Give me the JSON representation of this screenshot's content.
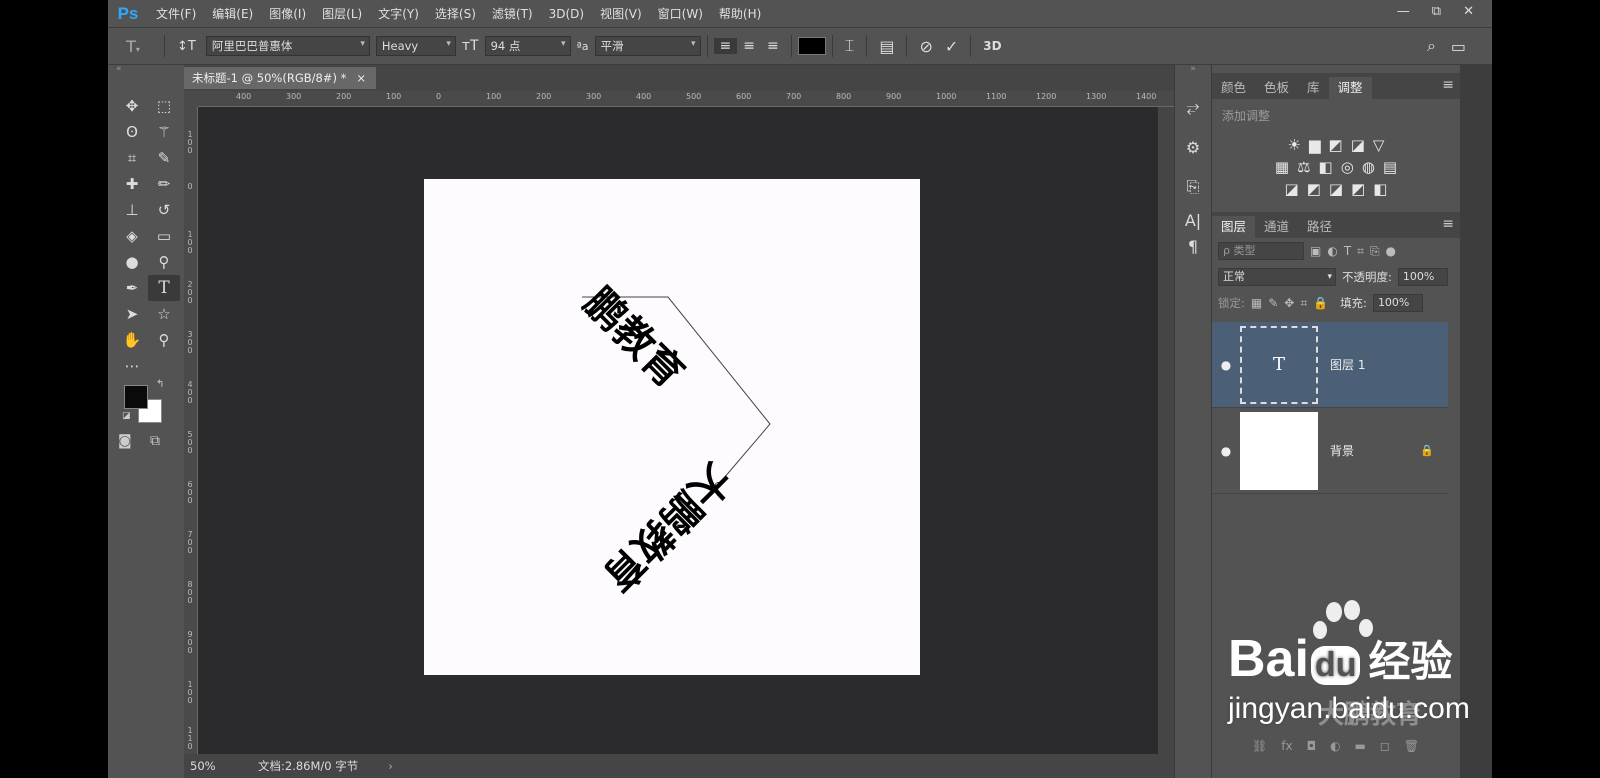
{
  "menu": {
    "logo": "Ps",
    "items": [
      "文件(F)",
      "编辑(E)",
      "图像(I)",
      "图层(L)",
      "文字(Y)",
      "选择(S)",
      "滤镜(T)",
      "3D(D)",
      "视图(V)",
      "窗口(W)",
      "帮助(H)"
    ]
  },
  "window_controls": {
    "minimize": "—",
    "restore": "⧉",
    "close": "✕"
  },
  "options": {
    "font_family": "阿里巴巴普惠体",
    "font_style": "Heavy",
    "font_size": "94 点",
    "aa_label": "ªa",
    "antialias": "平滑",
    "text_color": "#000000",
    "commit_3d": "3D"
  },
  "document": {
    "tab_title": "未标题-1 @ 50%(RGB/8#) *",
    "tab_close": "×",
    "zoom": "50%",
    "doc_info": "文档:2.86M/0 字节",
    "ruler_top": [
      "400",
      "300",
      "200",
      "100",
      "0",
      "100",
      "200",
      "300",
      "400",
      "500",
      "600",
      "700",
      "800",
      "900",
      "1000",
      "1100",
      "1200",
      "1300",
      "1400"
    ],
    "ruler_left": [
      "1\n0\n0",
      "0",
      "1\n0\n0",
      "2\n0\n0",
      "3\n0\n0",
      "4\n0\n0",
      "5\n0\n0",
      "6\n0\n0",
      "7\n0\n0",
      "8\n0\n0",
      "9\n0\n0",
      "1\n0\n0",
      "1\n1\n0"
    ],
    "path_text_upper": "鹏教育",
    "path_text_lower": "大鹏教育",
    "canvas_bg": "#2b2a2c"
  },
  "adjust_panel": {
    "tabs": [
      "颜色",
      "色板",
      "库",
      "调整"
    ],
    "active_tab": "调整",
    "title": "添加调整",
    "row1": [
      "☀",
      "▆",
      "◩",
      "◪",
      "▽"
    ],
    "row2": [
      "▦",
      "⚖",
      "◧",
      "◎",
      "◍",
      "▤"
    ],
    "row3": [
      "◪",
      "◩",
      "◪",
      "◩",
      "◧"
    ]
  },
  "layers_panel": {
    "tabs": [
      "图层",
      "通道",
      "路径"
    ],
    "active_tab": "图层",
    "filter_placeholder": "ρ 类型",
    "blend_mode": "正常",
    "opacity_label": "不透明度:",
    "opacity_value": "100%",
    "lock_label": "锁定:",
    "fill_label": "填充:",
    "fill_value": "100%",
    "layers": [
      {
        "name": "图层 1",
        "type": "text",
        "thumb_label": "T",
        "selected": true
      },
      {
        "name": "背景",
        "type": "image",
        "locked": true,
        "selected": false
      }
    ],
    "footer_icons": [
      "⛓",
      "fx",
      "◘",
      "◐",
      "▬",
      "◻",
      "🗑"
    ]
  },
  "watermark": {
    "brand": "Bai",
    "brand2": "du",
    "cn": "经验",
    "url": "jingyan.baidu.com",
    "overlay": "大鹏教育"
  },
  "colors": {
    "accent_layer": "#4b6077",
    "ps_blue": "#31a8ff"
  }
}
